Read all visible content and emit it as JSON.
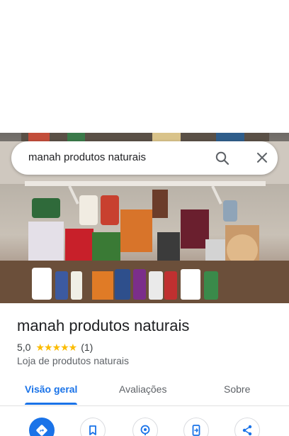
{
  "search": {
    "query": "manah produtos naturais"
  },
  "place": {
    "name": "manah produtos naturais",
    "rating": "5,0",
    "stars": "★★★★★",
    "review_count": "(1)",
    "category": "Loja de produtos naturais"
  },
  "tabs": [
    {
      "label": "Visão geral",
      "active": true
    },
    {
      "label": "Avaliações",
      "active": false
    },
    {
      "label": "Sobre",
      "active": false
    }
  ],
  "actions": [
    {
      "icon": "directions-icon"
    },
    {
      "icon": "bookmark-icon"
    },
    {
      "icon": "nearby-icon"
    },
    {
      "icon": "send-to-phone-icon"
    },
    {
      "icon": "share-icon"
    }
  ],
  "colors": {
    "accent": "#1a73e8",
    "star": "#fbbc04"
  }
}
